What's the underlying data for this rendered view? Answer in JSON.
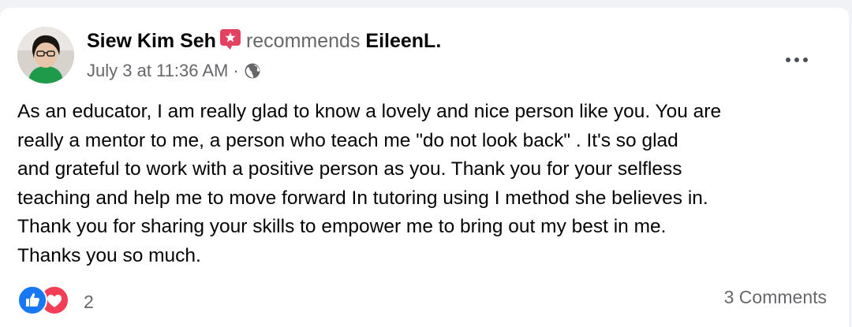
{
  "post": {
    "author": "Siew Kim Seh",
    "author_badge": "star-icon",
    "verb": "recommends",
    "target": "EileenL.",
    "date": "July 3 at 11:36 AM",
    "separator": "·",
    "audience_icon": "globe-icon",
    "body_lines": [
      "As an educator, I am really glad to know a lovely and nice person like you. You are",
      "really a mentor to me, a person who teach me \"do not look back\" . It's so glad",
      "and grateful to work with a positive person as you. Thank you for your selfless",
      "teaching and help me to move forward In tutoring using I method she believes in.",
      "Thank you for sharing your skills to empower me to bring out my best in me.",
      "Thanks you so much."
    ]
  },
  "footer": {
    "reaction_icons": [
      "like-icon",
      "love-icon"
    ],
    "reaction_count": "2",
    "comments": "3 Comments"
  },
  "colors": {
    "like": "#1877f2",
    "love": "#f33e58",
    "badge": "#e4405f",
    "secondary_text": "#65676b"
  }
}
